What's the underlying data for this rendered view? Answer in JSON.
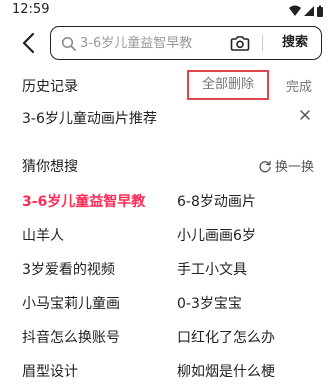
{
  "status": {
    "time": "12:59"
  },
  "search": {
    "placeholder": "3-6岁儿童益智早教",
    "button_label": "搜索"
  },
  "history": {
    "title": "历史记录",
    "delete_all_label": "全部删除",
    "done_label": "完成",
    "items": [
      {
        "label": "3-6岁儿童动画片推荐",
        "remove_label": "×"
      }
    ]
  },
  "suggest": {
    "title": "猜你想搜",
    "refresh_label": "换一换",
    "items": [
      {
        "label": "3-6岁儿童益智早教",
        "hot": true
      },
      {
        "label": "6-8岁动画片",
        "hot": false
      },
      {
        "label": "山羊人",
        "hot": false
      },
      {
        "label": "小儿画画6岁",
        "hot": false
      },
      {
        "label": "3岁爱看的视频",
        "hot": false
      },
      {
        "label": "手工小文具",
        "hot": false
      },
      {
        "label": "小马宝莉儿童画",
        "hot": false
      },
      {
        "label": "0-3岁宝宝",
        "hot": false
      },
      {
        "label": "抖音怎么换账号",
        "hot": false
      },
      {
        "label": "口红化了怎么办",
        "hot": false
      },
      {
        "label": "眉型设计",
        "hot": false
      },
      {
        "label": "柳如烟是什么梗",
        "hot": false
      }
    ]
  },
  "colors": {
    "accent": "#ff2c55",
    "highlight_border": "#e0454b"
  },
  "icons": [
    "wifi-icon",
    "signal-icon",
    "battery-icon",
    "back-arrow-icon",
    "search-icon",
    "camera-icon",
    "refresh-icon",
    "close-icon"
  ]
}
